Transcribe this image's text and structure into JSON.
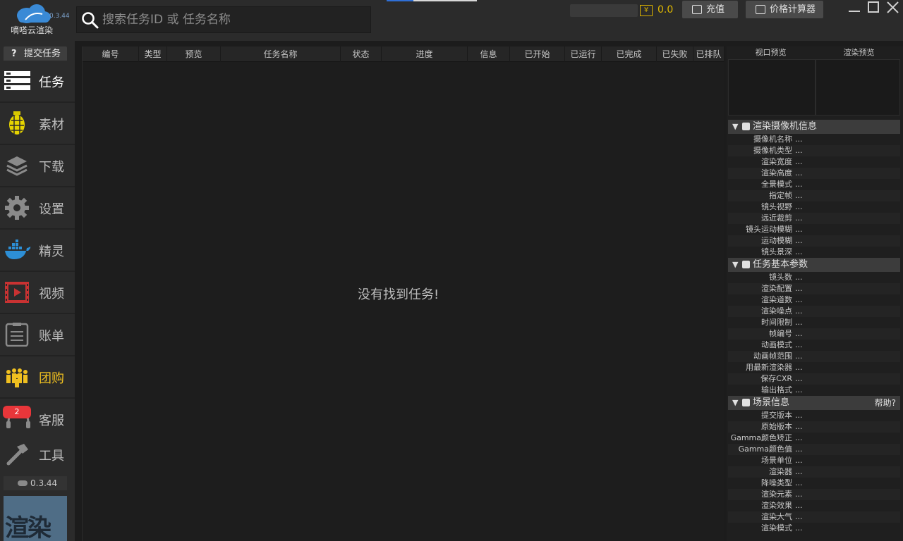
{
  "app": {
    "name": "嘀嗒云渲染",
    "version_small": "0.3.44"
  },
  "search": {
    "placeholder": "搜索任务ID 或 任务名称"
  },
  "account": {
    "coin_symbol": "¥",
    "balance": "0.0",
    "recharge_label": "充值",
    "calculator_label": "价格计算器"
  },
  "sidebar": {
    "submit_label": "提交任务",
    "items": [
      {
        "label": "任务",
        "icon": "tasks-icon"
      },
      {
        "label": "素材",
        "icon": "grenade-icon"
      },
      {
        "label": "下载",
        "icon": "layers-icon"
      },
      {
        "label": "设置",
        "icon": "gear-icon"
      },
      {
        "label": "精灵",
        "icon": "whale-icon"
      },
      {
        "label": "视频",
        "icon": "video-icon"
      },
      {
        "label": "账单",
        "icon": "bill-icon"
      },
      {
        "label": "团购",
        "icon": "group-buy-icon"
      },
      {
        "label": "客服",
        "icon": "headset-icon",
        "badge": "2"
      },
      {
        "label": "工具",
        "icon": "hammer-icon"
      }
    ],
    "version": "0.3.44",
    "promo_text": "渲染"
  },
  "table": {
    "columns": [
      "编号",
      "类型",
      "预览",
      "任务名称",
      "状态",
      "进度",
      "信息",
      "已开始",
      "已运行",
      "已完成",
      "已失败",
      "已排队"
    ],
    "empty_message": "没有找到任务!"
  },
  "right_panel": {
    "viewport_preview": "视口预览",
    "render_preview": "渲染预览",
    "sections": [
      {
        "title": "渲染摄像机信息",
        "rows": [
          "摄像机名称",
          "摄像机类型",
          "渲染宽度",
          "渲染高度",
          "全景模式",
          "指定帧",
          "镜头视野",
          "远近裁剪",
          "镜头运动模糊",
          "运动模糊",
          "镜头景深"
        ]
      },
      {
        "title": "任务基本参数",
        "rows": [
          "镜头数",
          "渲染配置",
          "渲染道数",
          "渲染噪点",
          "时间限制",
          "帧编号",
          "动画模式",
          "动画帧范围",
          "用最新渲染器",
          "保存CXR",
          "输出格式"
        ]
      },
      {
        "title": "场景信息",
        "help": "帮助?",
        "rows": [
          "提交版本",
          "原始版本",
          "Gamma颜色矫正",
          "Gamma颜色值",
          "场景单位",
          "渲染器",
          "降噪类型",
          "渲染元素",
          "渲染效果",
          "渲染大气",
          "渲染模式"
        ]
      }
    ],
    "value_placeholder": "..."
  },
  "colors": {
    "accent_gold": "#f0c020",
    "badge_red": "#e8363a",
    "logo_blue": "#3a8ad6"
  }
}
